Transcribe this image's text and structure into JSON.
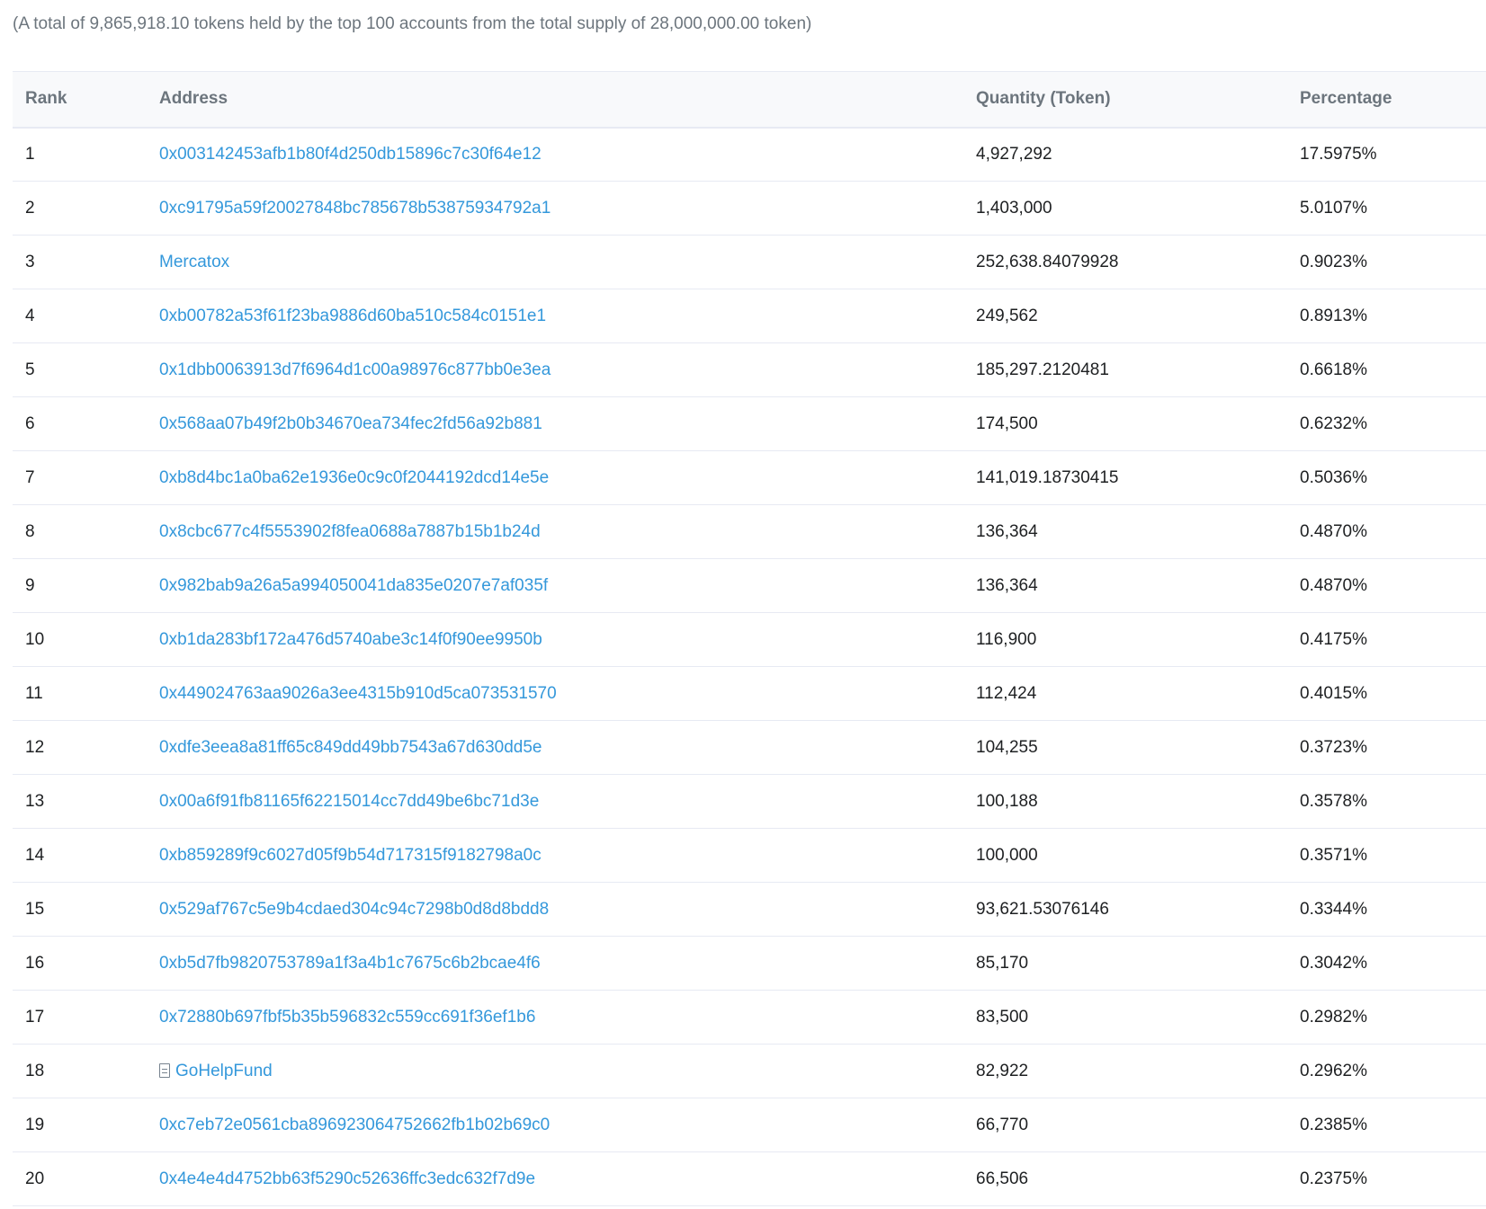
{
  "summary": "(A total of 9,865,918.10 tokens held by the top 100 accounts from the total supply of 28,000,000.00 token)",
  "columns": {
    "rank": "Rank",
    "address": "Address",
    "quantity": "Quantity (Token)",
    "percentage": "Percentage"
  },
  "colors": {
    "link": "#3498db",
    "muted": "#6c757d",
    "border": "#e7eaf3",
    "header_bg": "#f8f9fb"
  },
  "rows": [
    {
      "rank": "1",
      "address": "0x003142453afb1b80f4d250db15896c7c30f64e12",
      "quantity": "4,927,292",
      "percentage": "17.5975%"
    },
    {
      "rank": "2",
      "address": "0xc91795a59f20027848bc785678b53875934792a1",
      "quantity": "1,403,000",
      "percentage": "5.0107%"
    },
    {
      "rank": "3",
      "address": "Mercatox",
      "quantity": "252,638.84079928",
      "percentage": "0.9023%"
    },
    {
      "rank": "4",
      "address": "0xb00782a53f61f23ba9886d60ba510c584c0151e1",
      "quantity": "249,562",
      "percentage": "0.8913%"
    },
    {
      "rank": "5",
      "address": "0x1dbb0063913d7f6964d1c00a98976c877bb0e3ea",
      "quantity": "185,297.2120481",
      "percentage": "0.6618%"
    },
    {
      "rank": "6",
      "address": "0x568aa07b49f2b0b34670ea734fec2fd56a92b881",
      "quantity": "174,500",
      "percentage": "0.6232%"
    },
    {
      "rank": "7",
      "address": "0xb8d4bc1a0ba62e1936e0c9c0f2044192dcd14e5e",
      "quantity": "141,019.18730415",
      "percentage": "0.5036%"
    },
    {
      "rank": "8",
      "address": "0x8cbc677c4f5553902f8fea0688a7887b15b1b24d",
      "quantity": "136,364",
      "percentage": "0.4870%"
    },
    {
      "rank": "9",
      "address": "0x982bab9a26a5a994050041da835e0207e7af035f",
      "quantity": "136,364",
      "percentage": "0.4870%"
    },
    {
      "rank": "10",
      "address": "0xb1da283bf172a476d5740abe3c14f0f90ee9950b",
      "quantity": "116,900",
      "percentage": "0.4175%"
    },
    {
      "rank": "11",
      "address": "0x449024763aa9026a3ee4315b910d5ca073531570",
      "quantity": "112,424",
      "percentage": "0.4015%"
    },
    {
      "rank": "12",
      "address": "0xdfe3eea8a81ff65c849dd49bb7543a67d630dd5e",
      "quantity": "104,255",
      "percentage": "0.3723%"
    },
    {
      "rank": "13",
      "address": "0x00a6f91fb81165f62215014cc7dd49be6bc71d3e",
      "quantity": "100,188",
      "percentage": "0.3578%"
    },
    {
      "rank": "14",
      "address": "0xb859289f9c6027d05f9b54d717315f9182798a0c",
      "quantity": "100,000",
      "percentage": "0.3571%"
    },
    {
      "rank": "15",
      "address": "0x529af767c5e9b4cdaed304c94c7298b0d8d8bdd8",
      "quantity": "93,621.53076146",
      "percentage": "0.3344%"
    },
    {
      "rank": "16",
      "address": "0xb5d7fb9820753789a1f3a4b1c7675c6b2bcae4f6",
      "quantity": "85,170",
      "percentage": "0.3042%"
    },
    {
      "rank": "17",
      "address": "0x72880b697fbf5b35b596832c559cc691f36ef1b6",
      "quantity": "83,500",
      "percentage": "0.2982%"
    },
    {
      "rank": "18",
      "address": "GoHelpFund",
      "quantity": "82,922",
      "percentage": "0.2962%",
      "icon": "contract-document-icon"
    },
    {
      "rank": "19",
      "address": "0xc7eb72e0561cba896923064752662fb1b02b69c0",
      "quantity": "66,770",
      "percentage": "0.2385%"
    },
    {
      "rank": "20",
      "address": "0x4e4e4d4752bb63f5290c52636ffc3edc632f7d9e",
      "quantity": "66,506",
      "percentage": "0.2375%"
    }
  ]
}
